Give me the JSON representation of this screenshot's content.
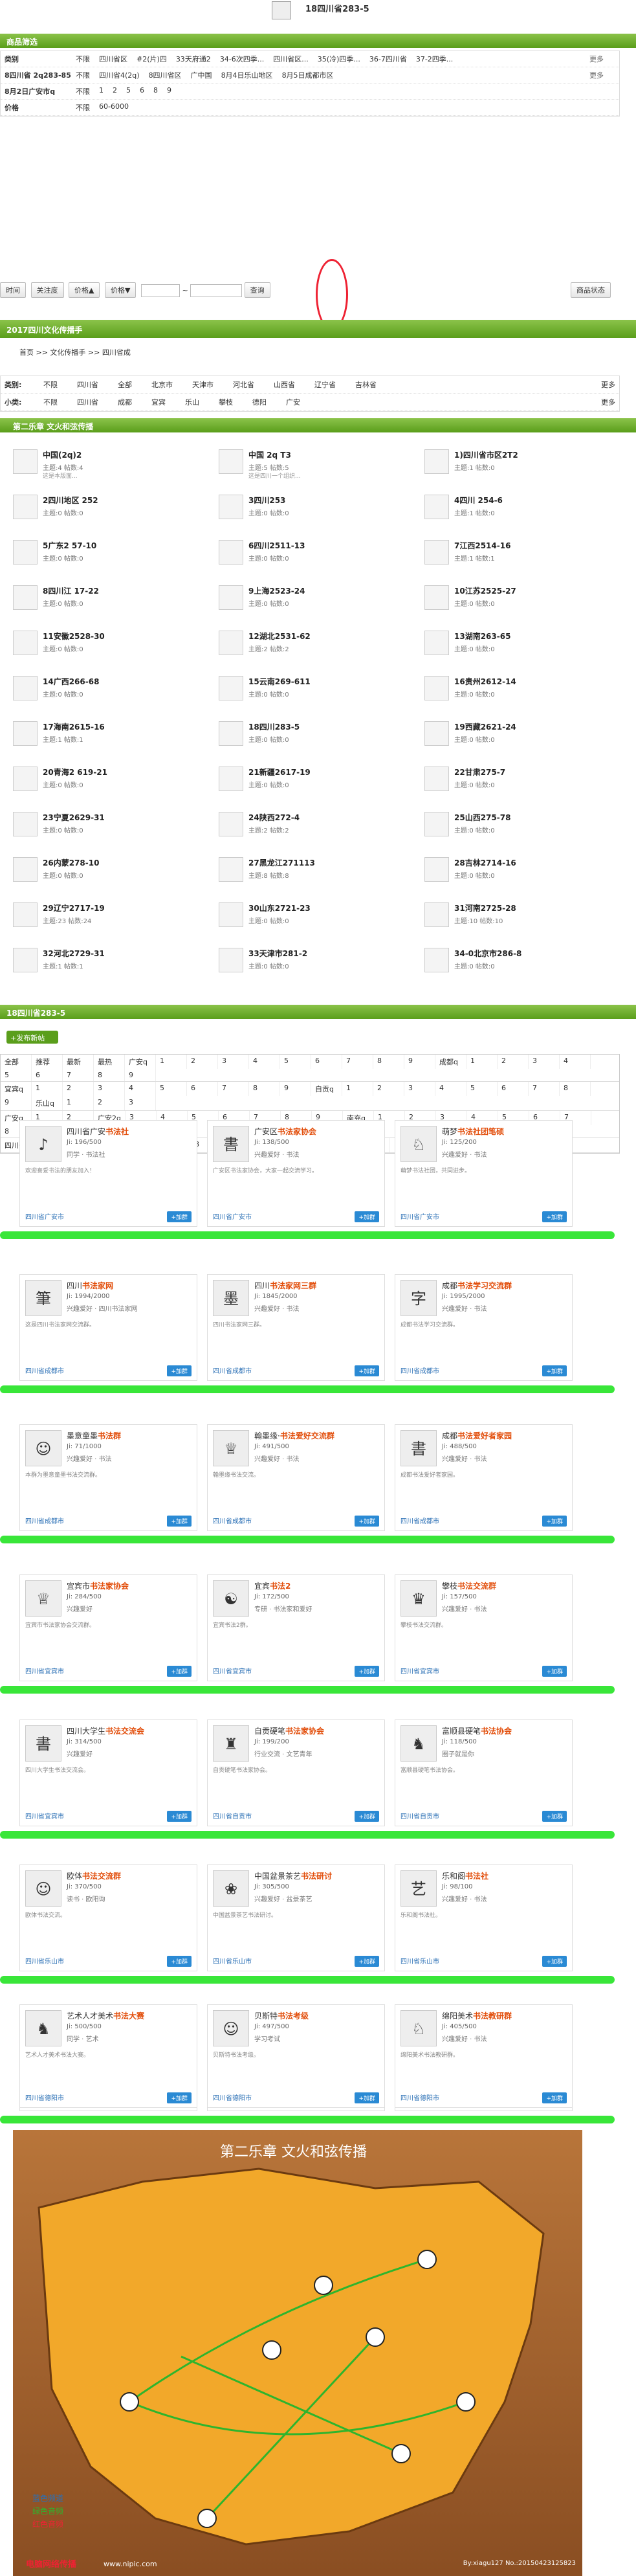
{
  "header": {
    "title": "18四川省283-5"
  },
  "filters": {
    "title": "商品筛选",
    "rows": [
      {
        "label": "类别",
        "options": [
          "不限",
          "四川省区",
          "#2(片)四",
          "33天府通2",
          "34-6次四季...",
          "四川省区...",
          "35(冷)四季...",
          "36-7四川省",
          "37-2四季..."
        ],
        "more": "更多"
      },
      {
        "label": "8四川省 2q283-85",
        "options": [
          "不限",
          "四川省4(2q)",
          "8四川省区",
          "广中国",
          "8月4日乐山地区",
          "8月5日成都市区"
        ],
        "more": "更多"
      },
      {
        "label": "8月2日广安市q",
        "options": [
          "不限",
          "1",
          "2",
          "5",
          "6",
          "8",
          "9"
        ],
        "more": ""
      },
      {
        "label": "价格",
        "options": [
          "不限",
          "60-6000"
        ],
        "more": ""
      }
    ]
  },
  "toolbar": {
    "b1": "时间",
    "b2": "关注度",
    "b3": "价格▲",
    "b4": "价格▼",
    "sep": "~",
    "search": "查询",
    "status": "商品状态"
  },
  "sec2": {
    "title": "2017四川文化传播手"
  },
  "crumb": "首页 >> 文化传播手 >> 四川省成",
  "sub": {
    "rows": [
      {
        "label": "类别:",
        "opts": [
          "不限",
          "四川省",
          "全部",
          "北京市",
          "天津市",
          "河北省",
          "山西省",
          "辽宁省",
          "吉林省"
        ],
        "more": "更多"
      },
      {
        "label": "小类:",
        "opts": [
          "不限",
          "四川省",
          "成都",
          "宜宾",
          "乐山",
          "攀枝",
          "德阳",
          "广安"
        ],
        "more": "更多"
      }
    ]
  },
  "sec3": {
    "title": "第二乐章  文火和弦传播"
  },
  "list": [
    [
      "中国(2q)2",
      "主题:4 帖数:4",
      "这是本版面..."
    ],
    [
      "中国 2q T3",
      "主题:5 帖数:5",
      "这是四川一个组织..."
    ],
    [
      "1)四川省市区2T2",
      "主题:1 帖数:0",
      ""
    ],
    [
      "2四川地区 252",
      "主题:0 帖数:0",
      ""
    ],
    [
      "3四川253",
      "主题:0 帖数:0",
      ""
    ],
    [
      "4四川 254-6",
      "主题:1 帖数:0",
      ""
    ],
    [
      "5广东2 57-10",
      "主题:0 帖数:0",
      ""
    ],
    [
      "6四川2511-13",
      "主题:0 帖数:0",
      ""
    ],
    [
      "7江西2514-16",
      "主题:1 帖数:1",
      ""
    ],
    [
      "8四川江 17-22",
      "主题:0 帖数:0",
      ""
    ],
    [
      "9上海2523-24",
      "主题:0 帖数:0",
      ""
    ],
    [
      "10江苏2525-27",
      "主题:0 帖数:0",
      ""
    ],
    [
      "11安徽2528-30",
      "主题:0 帖数:0",
      ""
    ],
    [
      "12湖北2531-62",
      "主题:2 帖数:2",
      ""
    ],
    [
      "13湖南263-65",
      "主题:0 帖数:0",
      ""
    ],
    [
      "14广西266-68",
      "主题:0 帖数:0",
      ""
    ],
    [
      "15云南269-611",
      "主题:0 帖数:0",
      ""
    ],
    [
      "16贵州2612-14",
      "主题:0 帖数:0",
      ""
    ],
    [
      "17海南2615-16",
      "主题:1 帖数:1",
      ""
    ],
    [
      "18四川283-5",
      "主题:0 帖数:0",
      ""
    ],
    [
      "19西藏2621-24",
      "主题:0 帖数:0",
      ""
    ],
    [
      "20青海2 619-21",
      "主题:0 帖数:0",
      ""
    ],
    [
      "21新疆2617-19",
      "主题:0 帖数:0",
      ""
    ],
    [
      "22甘肃275-7",
      "主题:0 帖数:0",
      ""
    ],
    [
      "23宁夏2629-31",
      "主题:0 帖数:0",
      ""
    ],
    [
      "24陕西272-4",
      "主题:2 帖数:2",
      ""
    ],
    [
      "25山西275-78",
      "主题:0 帖数:0",
      ""
    ],
    [
      "26内蒙278-10",
      "主题:0 帖数:0",
      ""
    ],
    [
      "27黑龙江271113",
      "主题:8 帖数:8",
      ""
    ],
    [
      "28吉林2714-16",
      "主题:0 帖数:0",
      ""
    ],
    [
      "29辽宁2717-19",
      "主题:23 帖数:24",
      ""
    ],
    [
      "30山东2721-23",
      "主题:0 帖数:0",
      ""
    ],
    [
      "31河南2725-28",
      "主题:10 帖数:10",
      ""
    ],
    [
      "32河北2729-31",
      "主题:1 帖数:1",
      ""
    ],
    [
      "33天津市281-2",
      "主题:0 帖数:0",
      ""
    ],
    [
      "34-0北京市286-8",
      "主题:0 帖数:0",
      ""
    ]
  ],
  "sec4": {
    "title": "18四川省283-5"
  },
  "add_btn": "+发布新帖",
  "loc": {
    "r1": [
      "全部",
      "推荐",
      "最新",
      "最热",
      "广安q",
      "1",
      "2",
      "3",
      "4",
      "5",
      "6",
      "7",
      "8",
      "9",
      "成都q",
      "1",
      "2",
      "3",
      "4",
      "5",
      "6",
      "7",
      "8",
      "9"
    ],
    "r2": [
      "宜宾q",
      "1",
      "2",
      "3",
      "4",
      "5",
      "6",
      "7",
      "8",
      "9",
      "自贡q",
      "1",
      "2",
      "3",
      "4",
      "5",
      "6",
      "7",
      "8",
      "9",
      "乐山q",
      "1",
      "2",
      "3"
    ],
    "r3": [
      "广安q",
      "1",
      "2",
      "广安2q",
      "3",
      "4",
      "5",
      "6",
      "7",
      "8",
      "9",
      "南充q",
      "1",
      "2",
      "3",
      "4",
      "5",
      "6",
      "7",
      "8",
      "9"
    ],
    "r4": [
      "四川省成都q",
      "8",
      "四川省攀枝q",
      "5",
      "8",
      "8",
      "7四川文化传播群q",
      "8",
      "四川和谐文化传播q"
    ]
  },
  "cards": [
    {
      "logo": "♪",
      "t1": "四川省广安",
      "t2": "书法社",
      "n": "Ji: 196/500",
      "s": "同学 · 书法社",
      "d": "欢迎喜爱书法的朋友加入！",
      "l": "四川省广安市",
      "b": "+加群"
    },
    {
      "logo": "書",
      "t1": "广安区",
      "t2": "书法家协会",
      "n": "Ji: 138/500",
      "s": "兴趣爱好 · 书法",
      "d": "广安区书法家协会，大家一起交流学习。",
      "l": "四川省广安市",
      "b": "+加群"
    },
    {
      "logo": "♘",
      "t1": "萌梦",
      "t2": "书法社团笔硕",
      "n": "Ji: 125/200",
      "s": "兴趣爱好 · 书法",
      "d": "萌梦书法社团，共同进步。",
      "l": "四川省广安市",
      "b": "+加群"
    },
    {
      "logo": "筆",
      "t1": "四川",
      "t2": "书法家网",
      "n": "Ji: 1994/2000",
      "s": "兴趣爱好 · 四川书法家网",
      "d": "这是四川书法家网交流群。",
      "l": "四川省成都市",
      "b": "+加群"
    },
    {
      "logo": "墨",
      "t1": "四川",
      "t2": "书法家网三群",
      "n": "Ji: 1845/2000",
      "s": "兴趣爱好 · 书法",
      "d": "四川书法家网三群。",
      "l": "四川省成都市",
      "b": "+加群"
    },
    {
      "logo": "字",
      "t1": "成都",
      "t2": "书法学习交流群",
      "n": "Ji: 1995/2000",
      "s": "兴趣爱好 · 书法",
      "d": "成都书法学习交流群。",
      "l": "四川省成都市",
      "b": "+加群"
    },
    {
      "logo": "☺",
      "t1": "墨意童墨",
      "t2": "书法群",
      "n": "Ji: 71/1000",
      "s": "兴趣爱好 · 书法",
      "d": "本群为墨意童墨书法交流群。",
      "l": "四川省成都市",
      "b": "+加群"
    },
    {
      "logo": "♕",
      "t1": "翰墨缘·",
      "t2": "书法爱好交流群",
      "n": "Ji: 491/500",
      "s": "兴趣爱好 · 书法",
      "d": "翰墨缘书法交流。",
      "l": "四川省成都市",
      "b": "+加群"
    },
    {
      "logo": "書",
      "t1": "成都",
      "t2": "书法爱好者家园",
      "n": "Ji: 488/500",
      "s": "兴趣爱好 · 书法",
      "d": "成都书法爱好者家园。",
      "l": "四川省成都市",
      "b": "+加群"
    },
    {
      "logo": "♕",
      "t1": "宜宾市",
      "t2": "书法家协会",
      "n": "Ji: 284/500",
      "s": "兴趣爱好",
      "d": "宜宾市书法家协会交流群。",
      "l": "四川省宜宾市",
      "b": "+加群"
    },
    {
      "logo": "☯",
      "t1": "宜宾",
      "t2": "书法2",
      "n": "Ji: 172/500",
      "s": "专研 · 书法家和爱好",
      "d": "宜宾书法2群。",
      "l": "四川省宜宾市",
      "b": "+加群"
    },
    {
      "logo": "♛",
      "t1": "攀枝",
      "t2": "书法交流群",
      "n": "Ji: 157/500",
      "s": "兴趣爱好 · 书法",
      "d": "攀枝书法交流群。",
      "l": "四川省宜宾市",
      "b": "+加群"
    },
    {
      "logo": "書",
      "t1": "四川大学生",
      "t2": "书法交流会",
      "n": "Ji: 314/500",
      "s": "兴趣爱好",
      "d": "四川大学生书法交流会。",
      "l": "四川省宜宾市",
      "b": "+加群"
    },
    {
      "logo": "♜",
      "t1": "自贡硬笔",
      "t2": "书法家协会",
      "n": "Ji: 199/200",
      "s": "行业交流 · 文艺青年",
      "d": "自贡硬笔书法家协会。",
      "l": "四川省自贡市",
      "b": "+加群"
    },
    {
      "logo": "♞",
      "t1": "富顺县硬笔",
      "t2": "书法协会",
      "n": "Ji: 118/500",
      "s": "圈子就是你",
      "d": "富顺县硬笔书法协会。",
      "l": "四川省自贡市",
      "b": "+加群"
    },
    {
      "logo": "☺",
      "t1": "欧体",
      "t2": "书法交流群",
      "n": "Ji: 370/500",
      "s": "读书 · 欧阳询",
      "d": "欧体书法交流。",
      "l": "四川省乐山市",
      "b": "+加群"
    },
    {
      "logo": "❀",
      "t1": "中国盆景茶艺",
      "t2": "书法研讨",
      "n": "Ji: 305/500",
      "s": "兴趣爱好 · 盆景茶艺",
      "d": "中国盆景茶艺书法研讨。",
      "l": "四川省乐山市",
      "b": "+加群"
    },
    {
      "logo": "艺",
      "t1": "乐和阁",
      "t2": "书法社",
      "n": "Ji: 98/100",
      "s": "兴趣爱好 · 书法",
      "d": "乐和阁书法社。",
      "l": "四川省乐山市",
      "b": "+加群"
    },
    {
      "logo": "歐",
      "t1": "欧指硬笔",
      "t2": "书法练字群",
      "n": "Ji: 812/2000",
      "s": "学习考试 · 书法",
      "d": "欧指硬笔书法练字群。",
      "l": "四川省德阳市",
      "b": "+加群"
    },
    {
      "logo": "♚",
      "t1": "米芾、二王",
      "t2": "书法交流群",
      "n": "Ji: 478/500",
      "s": "兴趣爱好 · 书法",
      "d": "米芾、二王书法交流群。",
      "l": "四川省德阳市",
      "b": "+加群"
    },
    {
      "logo": "德",
      "t1": "德阳市硬笔",
      "t2": "书法协会",
      "n": "Ji: 363/500",
      "s": "兴趣爱好 · 书法",
      "d": "德阳市硬笔书法协会。",
      "l": "四川省德阳市",
      "b": "+加群"
    },
    {
      "logo": "♞",
      "t1": "艺术人才美术",
      "t2": "书法大赛",
      "n": "Ji: 500/500",
      "s": "同学 · 艺术",
      "d": "艺术人才美术书法大赛。",
      "l": "四川省德阳市",
      "b": "+加群"
    },
    {
      "logo": "☺",
      "t1": "贝斯特",
      "t2": "书法考级",
      "n": "Ji: 497/500",
      "s": "学习考试",
      "d": "贝斯特书法考级。",
      "l": "四川省德阳市",
      "b": "+加群"
    },
    {
      "logo": "♘",
      "t1": "绵阳美术",
      "t2": "书法教研群",
      "n": "Ji: 405/500",
      "s": "兴趣爱好 · 书法",
      "d": "绵阳美术书法教研群。",
      "l": "四川省德阳市",
      "b": "+加群"
    }
  ],
  "map": {
    "title": "第二乐章  文火和弦传播",
    "footer_left": "www.nipic.com",
    "footer_right": "By:xiagu127  No.:20150423125823",
    "legend": [
      "蓝色频道",
      "绿色音频",
      "红色音频"
    ],
    "brand": "电脑网络传播"
  }
}
